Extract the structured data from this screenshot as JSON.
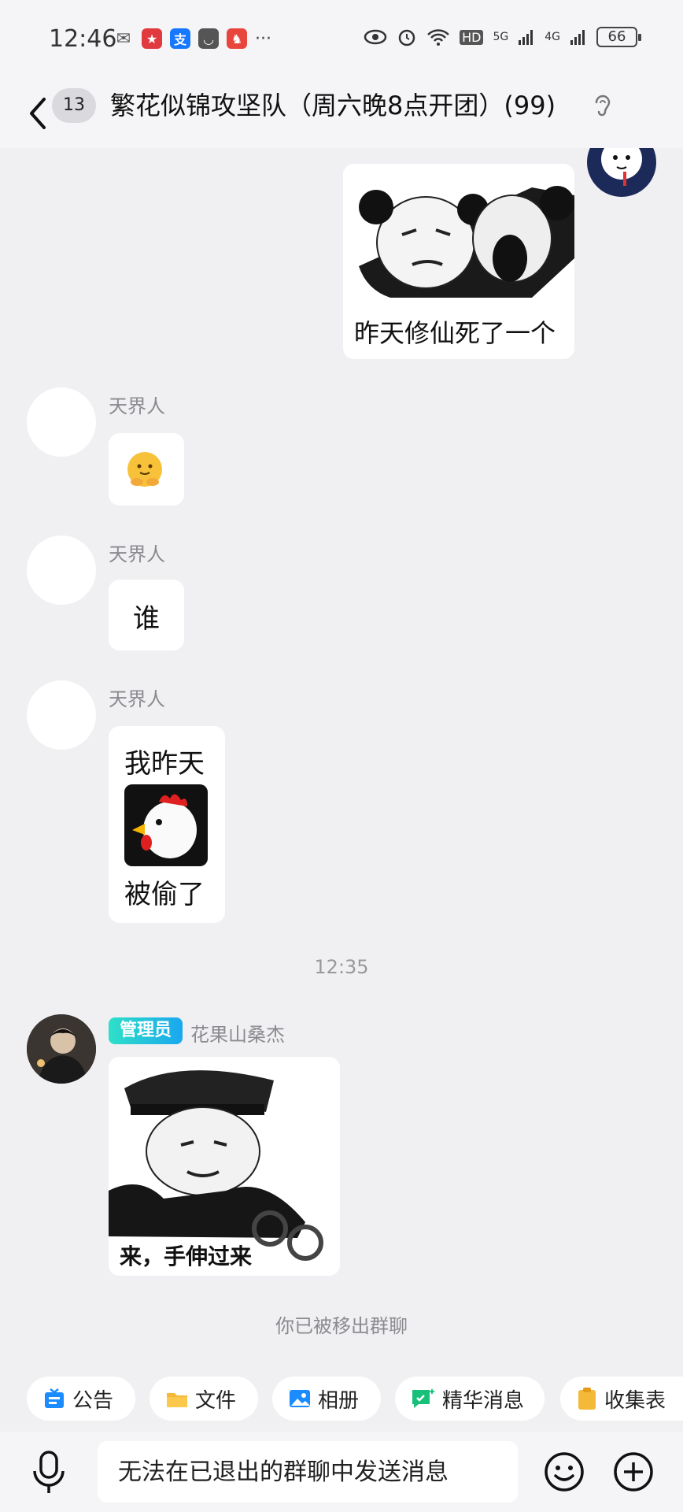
{
  "status_bar": {
    "time": "12:46",
    "more": "···",
    "battery": "66",
    "net_hd": "HD",
    "net_5g": "5G",
    "net_4g": "4G"
  },
  "header": {
    "unread_count": "13",
    "title": "繁花似锦攻坚队（周六晚8点开团）(99)"
  },
  "messages": {
    "m1": {
      "caption": "昨天修仙死了一个"
    },
    "m2": {
      "sender": "天界人"
    },
    "m3": {
      "sender": "天界人",
      "text": "谁"
    },
    "m4": {
      "sender": "天界人",
      "line1": "我昨天",
      "line2": "被偷了"
    },
    "timestamp": "12:35",
    "m5": {
      "role": "管理员",
      "sender": "花果山桑杰",
      "caption": "来，手伸过来"
    },
    "notice": "你已被移出群聊"
  },
  "quick_bar": {
    "announcement": "公告",
    "files": "文件",
    "album": "相册",
    "highlights": "精华消息",
    "forms": "收集表"
  },
  "input": {
    "placeholder": "无法在已退出的群聊中发送消息"
  },
  "colors": {
    "accent_blue": "#1aa7ef",
    "admin_tag": "#2ee0c7",
    "background": "#f0f0f3"
  }
}
